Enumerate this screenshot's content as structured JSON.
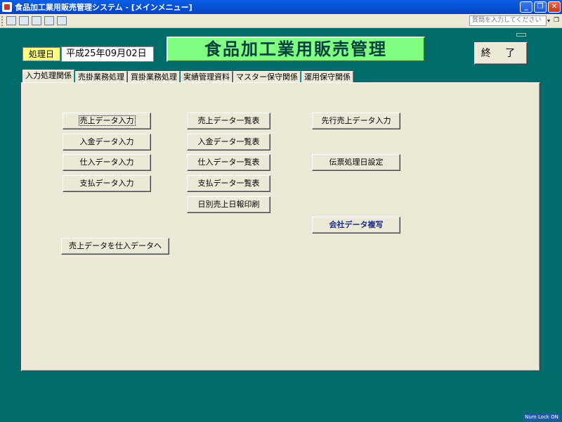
{
  "window": {
    "title": "食品加工業用販売管理システム - [メインメニュー]",
    "minimize": "_",
    "restore": "❐",
    "close": "✕"
  },
  "toolbar": {
    "help_placeholder": "質問を入力してください",
    "help_arrow": "▾",
    "restore_glyph": "❐"
  },
  "header": {
    "date_label": "処理日",
    "date_value": "平成25年09月02日",
    "main_title": "食品加工業用販売管理",
    "exit_label": "終 了"
  },
  "tabs": [
    {
      "label": "入力処理関係",
      "active": true
    },
    {
      "label": "売掛業務処理",
      "active": false
    },
    {
      "label": "買掛業務処理",
      "active": false
    },
    {
      "label": "実績管理資料",
      "active": false
    },
    {
      "label": "マスター保守関係",
      "active": false
    },
    {
      "label": "運用保守関係",
      "active": false
    }
  ],
  "buttons": {
    "sales_entry": "売上データ入力",
    "receipt_entry": "入金データ入力",
    "purchase_entry": "仕入データ入力",
    "payment_entry": "支払データ入力",
    "sales_list": "売上データ一覧表",
    "receipt_list": "入金データ一覧表",
    "purchase_list": "仕入データ一覧表",
    "payment_list": "支払データ一覧表",
    "daily_sales_print": "日別売上日報印刷",
    "advance_sales_entry": "先行売上データ入力",
    "slip_date_setting": "伝票処理日設定",
    "company_copy": "会社データ複写",
    "sales_to_purchase": "売上データを仕入データへ"
  },
  "status": {
    "numlock": "Num Lock ON"
  },
  "colors": {
    "background": "#006b6b",
    "title_bg": "#80ff80",
    "date_label_bg": "#ffff80",
    "panel_bg": "#ece9d8"
  }
}
